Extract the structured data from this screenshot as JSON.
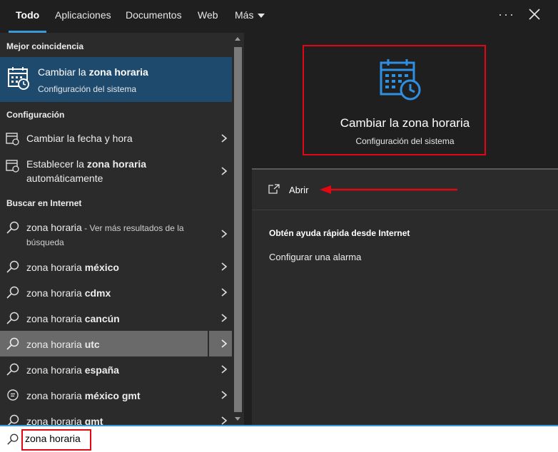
{
  "tabs": [
    "Todo",
    "Aplicaciones",
    "Documentos",
    "Web",
    "Más"
  ],
  "toolbar": {
    "more": "···"
  },
  "best_match": {
    "section": "Mejor coincidencia",
    "title_plain": "Cambiar la ",
    "title_bold": "zona horaria",
    "subtitle": "Configuración del sistema"
  },
  "settings": {
    "section": "Configuración",
    "items": [
      {
        "plain": "Cambiar la fecha y hora",
        "bold": ""
      },
      {
        "plain": "Establecer la ",
        "bold": "zona horaria",
        "line2": "automáticamente"
      }
    ]
  },
  "web": {
    "section": "Buscar en Internet",
    "first": {
      "plain": "zona horaria",
      "hint": " - Ver más resultados de la",
      "hint2": "búsqueda"
    },
    "items": [
      {
        "plain": "zona horaria ",
        "bold": "méxico"
      },
      {
        "plain": "zona horaria ",
        "bold": "cdmx"
      },
      {
        "plain": "zona horaria ",
        "bold": "cancún"
      },
      {
        "plain": "zona horaria ",
        "bold": "utc"
      },
      {
        "plain": "zona horaria ",
        "bold": "españa"
      },
      {
        "plain": "zona horaria ",
        "bold": "méxico gmt"
      },
      {
        "plain": "zona horaria ",
        "bold": "gmt"
      }
    ]
  },
  "preview": {
    "title": "Cambiar la zona horaria",
    "subtitle": "Configuración del sistema",
    "open": "Abrir",
    "help_title": "Obtén ayuda rápida desde Internet",
    "help_link": "Configurar una alarma"
  },
  "search": {
    "value": "zona horaria"
  },
  "colors": {
    "accent": "#3a9ad9",
    "selection": "#1e4a6e",
    "annotation": "#e30613",
    "icon_blue": "#2f8fe0"
  }
}
